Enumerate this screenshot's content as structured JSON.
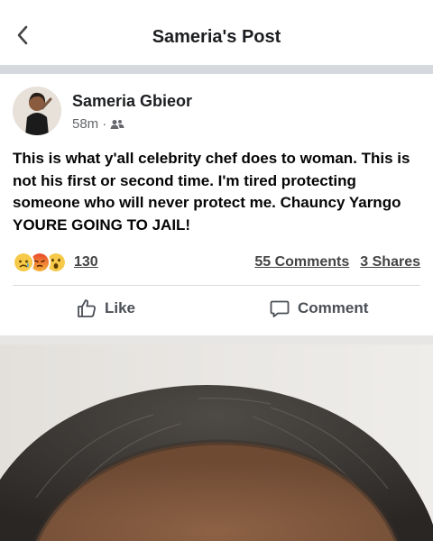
{
  "header": {
    "title": "Sameria's Post",
    "back_icon": "chevron-left-icon"
  },
  "post": {
    "author": "Sameria Gbieor",
    "time": "58m",
    "separator": "·",
    "audience_icon": "friends-icon",
    "text": "This is what y'all celebrity chef does to woman. This is not his first or second time. I'm tired protecting someone who will never protect me. Chauncy Yarngo YOURE GOING TO JAIL!",
    "reactions": {
      "icons": [
        "sad-icon",
        "angry-icon",
        "wow-icon"
      ],
      "count": "130"
    },
    "comments": "55 Comments",
    "shares": "3 Shares",
    "actions": {
      "like": "Like",
      "like_icon": "thumbs-up-icon",
      "comment": "Comment",
      "comment_icon": "comment-icon"
    }
  },
  "colors": {
    "background": "#f0f1f3",
    "text": "#1c1e21",
    "secondary_text": "#65676b",
    "divider": "#dadde1"
  }
}
